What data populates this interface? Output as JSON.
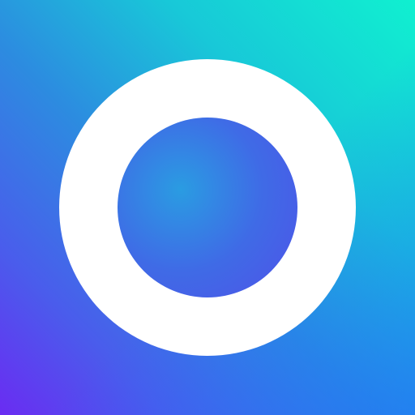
{
  "icon": {
    "name": "ring-logo-icon",
    "colors": {
      "gradient_top_right": "#10F0D0",
      "gradient_mid": "#2C8CE0",
      "gradient_bottom_left": "#6A2CF2",
      "gradient_bottom_right": "#1E6EFF",
      "ring": "#FFFFFF"
    }
  }
}
